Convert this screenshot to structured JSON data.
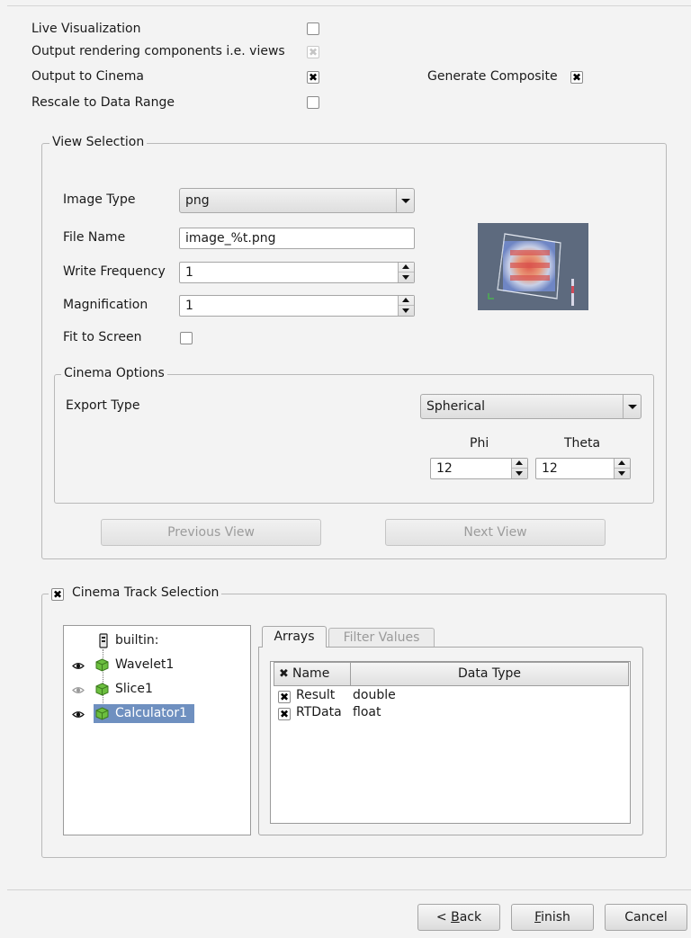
{
  "options": {
    "live_visualization": {
      "label": "Live Visualization",
      "checked": false
    },
    "output_views": {
      "label": "Output rendering components i.e. views",
      "checked": true,
      "disabled": true
    },
    "output_cinema": {
      "label": "Output to Cinema",
      "checked": true
    },
    "generate_composite": {
      "label": "Generate Composite",
      "checked": true
    },
    "rescale": {
      "label": "Rescale to Data Range",
      "checked": false
    }
  },
  "view_selection": {
    "title": "View Selection",
    "image_type_label": "Image Type",
    "image_type_value": "png",
    "file_name_label": "File Name",
    "file_name_value": "image_%t.png",
    "write_frequency_label": "Write Frequency",
    "write_frequency_value": "1",
    "magnification_label": "Magnification",
    "magnification_value": "1",
    "fit_to_screen_label": "Fit to Screen",
    "fit_to_screen_checked": false,
    "cinema_options": {
      "title": "Cinema Options",
      "export_type_label": "Export Type",
      "export_type_value": "Spherical",
      "phi_label": "Phi",
      "phi_value": "12",
      "theta_label": "Theta",
      "theta_value": "12"
    },
    "previous_view": "Previous View",
    "next_view": "Next View"
  },
  "track_selection": {
    "title": "Cinema Track Selection",
    "checked": true,
    "pipeline": [
      {
        "label": "builtin:",
        "icon": "server-icon",
        "eye": "none",
        "selected": false
      },
      {
        "label": "Wavelet1",
        "icon": "cube-icon",
        "eye": "visible",
        "selected": false
      },
      {
        "label": "Slice1",
        "icon": "cube-icon",
        "eye": "dimmed",
        "selected": false
      },
      {
        "label": "Calculator1",
        "icon": "cube-icon",
        "eye": "visible",
        "selected": true
      }
    ],
    "tabs": [
      {
        "label": "Arrays",
        "active": true
      },
      {
        "label": "Filter Values",
        "active": false
      }
    ],
    "columns": [
      "Name",
      "Data Type"
    ],
    "arrays": [
      {
        "name": "Result",
        "type": "double",
        "checked": true
      },
      {
        "name": "RTData",
        "type": "float",
        "checked": true
      }
    ]
  },
  "footer": {
    "back_prefix": "< ",
    "back_mnemonic": "B",
    "back_rest": "ack",
    "finish_mnemonic": "F",
    "finish_rest": "inish",
    "cancel": "Cancel"
  },
  "colors": {
    "selection": "#6f90c0",
    "cube_green": "#6cbf3f",
    "preview_bg": "#5d6a7e"
  }
}
